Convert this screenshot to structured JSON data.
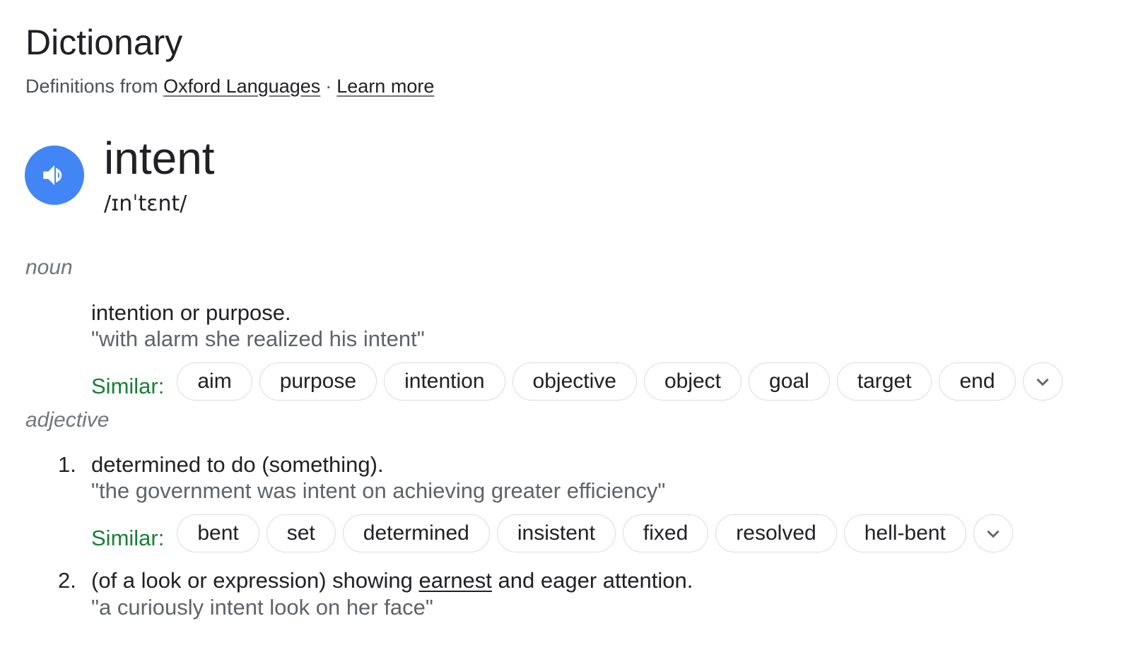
{
  "header": {
    "title": "Dictionary",
    "source_prefix": "Definitions from",
    "source_link": "Oxford Languages",
    "separator": "·",
    "learn_more": "Learn more"
  },
  "entry": {
    "word": "intent",
    "phonetic": "/ɪnˈtɛnt/",
    "audio_icon": "speaker-icon",
    "accent_color": "#4285f4"
  },
  "noun": {
    "label": "noun",
    "definition": "intention or purpose.",
    "example": "\"with alarm she realized his intent\"",
    "similar_label": "Similar:",
    "similar": [
      "aim",
      "purpose",
      "intention",
      "objective",
      "object",
      "goal",
      "target",
      "end"
    ],
    "more_icon": "chevron-down-icon"
  },
  "adjective": {
    "label": "adjective",
    "senses": [
      {
        "number": "1.",
        "definition": "determined to do (something).",
        "example": "\"the government was intent on achieving greater efficiency\"",
        "similar_label": "Similar:",
        "similar": [
          "bent",
          "set",
          "determined",
          "insistent",
          "fixed",
          "resolved",
          "hell-bent"
        ]
      },
      {
        "number": "2.",
        "definition_before": "(of a look or expression) showing ",
        "definition_link": "earnest",
        "definition_after": " and eager attention.",
        "example": "\"a curiously intent look on her face\""
      }
    ]
  },
  "colors": {
    "similar_label": "#188038",
    "example_text": "#5f6368",
    "pos_label": "#70757a"
  }
}
